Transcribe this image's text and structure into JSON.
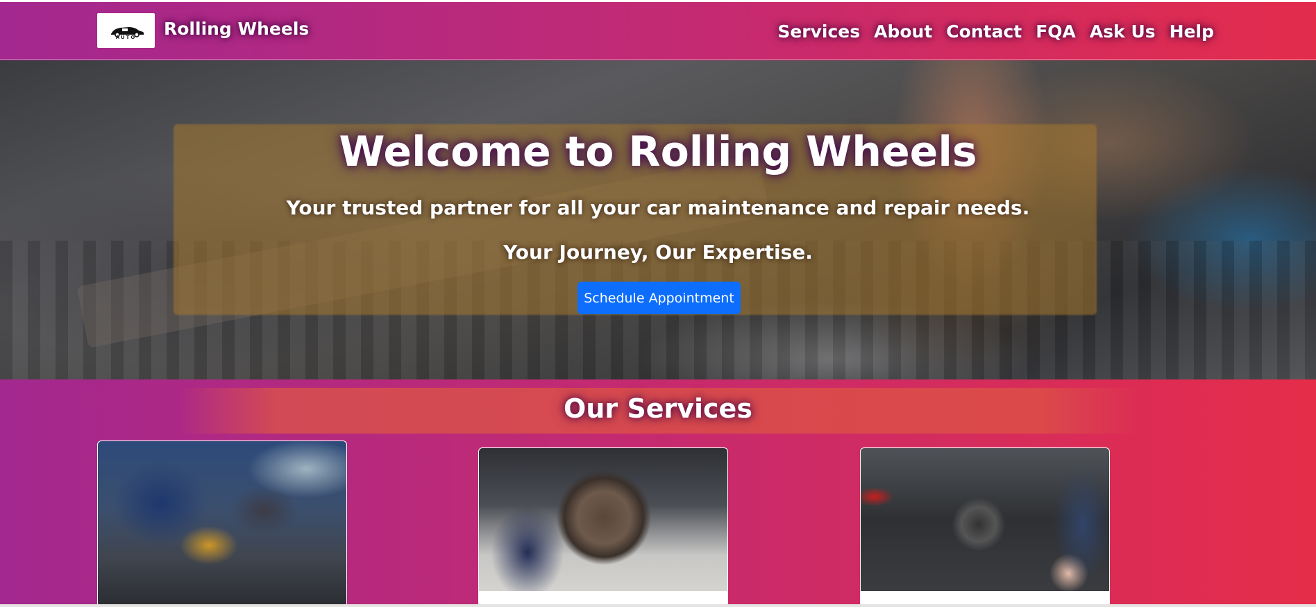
{
  "navbar": {
    "brand": "Rolling Wheels",
    "logo_text": "AUTO",
    "links": [
      "Services",
      "About",
      "Contact",
      "FQA",
      "Ask Us",
      "Help"
    ]
  },
  "hero": {
    "title": "Welcome to Rolling Wheels",
    "subtitle": "Your trusted partner for all your car maintenance and repair needs.",
    "tagline": "Your Journey, Our Expertise.",
    "cta_label": "Schedule Appointment"
  },
  "services": {
    "title": "Our Services"
  },
  "colors": {
    "gradient_start": "#a3288f",
    "gradient_end": "#e52d4a",
    "button": "#0d6efd"
  }
}
